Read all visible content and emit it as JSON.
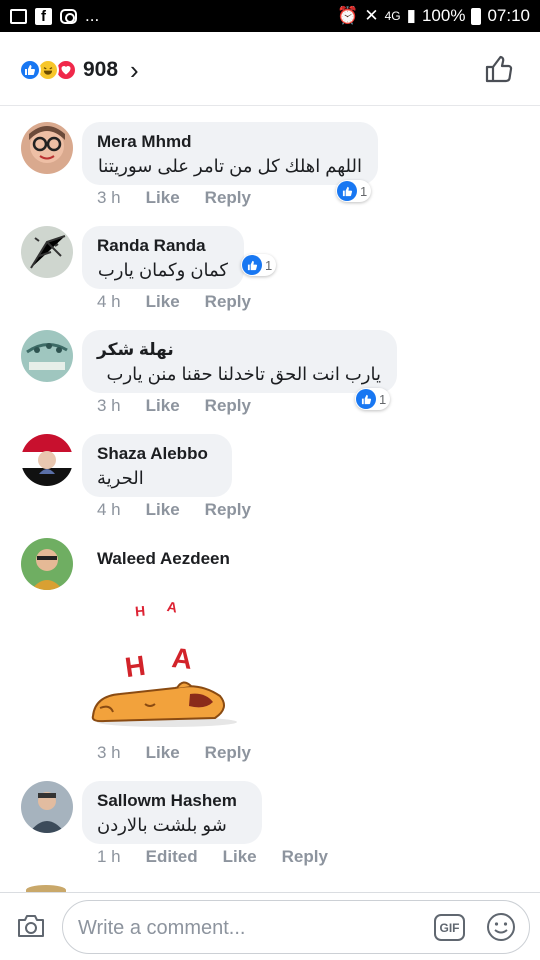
{
  "status_bar": {
    "left_icons": [
      "image-icon",
      "facebook-icon",
      "instagram-icon",
      "more-notifications-icon"
    ],
    "more": "...",
    "network": "4G",
    "battery": "100%",
    "time": "07:10"
  },
  "header": {
    "reaction_icons": [
      "like",
      "haha",
      "love"
    ],
    "reaction_count": "908",
    "chevron": "›"
  },
  "comments": [
    {
      "name": "Mera Mhmd",
      "text": "اللهم اهلك كل من تامر على سوريتنا",
      "time": "3 h",
      "like": "Like",
      "reply": "Reply",
      "likes": "1"
    },
    {
      "name": "Randa Randa",
      "text": "كمان وكمان يارب",
      "time": "4 h",
      "like": "Like",
      "reply": "Reply",
      "likes": "1"
    },
    {
      "name": "نهلة شكر",
      "text": "يارب انت الحق تاخدلنا حقنا منن يارب",
      "time": "3 h",
      "like": "Like",
      "reply": "Reply",
      "likes": "1"
    },
    {
      "name": "Shaza Alebbo",
      "text": "الحرية",
      "time": "4 h",
      "like": "Like",
      "reply": "Reply"
    },
    {
      "name": "Waleed Aezdeen",
      "sticker_text": [
        "H",
        "A",
        "H",
        "A"
      ],
      "time": "3 h",
      "like": "Like",
      "reply": "Reply"
    },
    {
      "name": "Sallowm Hashem",
      "text": "شو بلشت بالاردن",
      "time": "1 h",
      "edited": "Edited",
      "like": "Like",
      "reply": "Reply"
    }
  ],
  "composer": {
    "placeholder": "Write a comment...",
    "gif": "GIF"
  },
  "colors": {
    "accent": "#1877f2",
    "bubble": "#f0f2f5",
    "meta": "#8d949e"
  }
}
